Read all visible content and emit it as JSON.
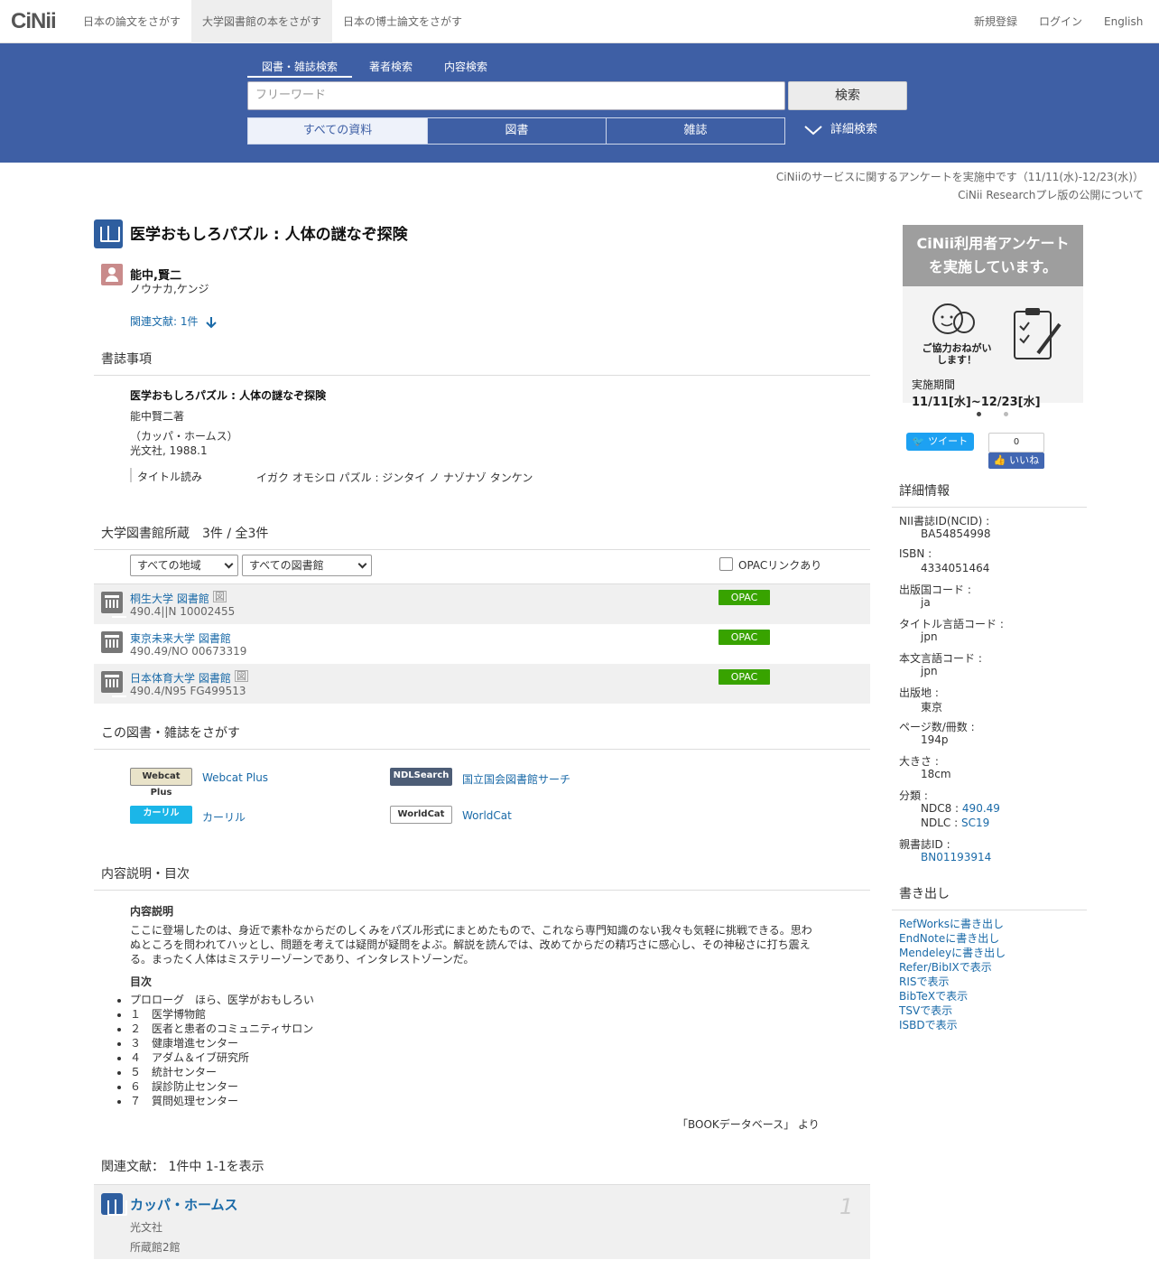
{
  "header": {
    "logo": "CiNii",
    "nav": [
      "日本の論文をさがす",
      "大学図書館の本をさがす",
      "日本の博士論文をさがす"
    ],
    "right": [
      "新規登録",
      "ログイン",
      "English"
    ]
  },
  "search": {
    "tabs": [
      "図書・雑誌検索",
      "著者検索",
      "内容検索"
    ],
    "placeholder": "フリーワード",
    "button": "検索",
    "filters": [
      "すべての資料",
      "図書",
      "雑誌"
    ],
    "advanced": "詳細検索"
  },
  "notices": [
    "CiNiiのサービスに関するアンケートを実施中です（11/11(水)-12/23(水)）",
    "CiNii Researchプレ版の公開について"
  ],
  "book": {
    "title": "医学おもしろパズル : 人体の謎なぞ探険",
    "author": "能中,賢二",
    "author_kana": "ノウナカ,ケンジ",
    "related_link": "関連文献: 1件"
  },
  "biblio": {
    "heading": "書誌事項",
    "title": "医学おもしろパズル : 人体の謎なぞ探険",
    "author_line": "能中賢二著",
    "series": "（カッパ・ホームス）",
    "publisher": "光文社, 1988.1",
    "reading_label": "タイトル読み",
    "reading_value": "イガク オモシロ パズル : ジンタイ ノ ナゾナゾ タンケン"
  },
  "holdings": {
    "heading": "大学図書館所蔵　3件 / 全3件",
    "region_select": "すべての地域",
    "library_select": "すべての図書館",
    "opac_filter": "OPACリンクあり",
    "opac_label": "OPAC",
    "list_icon": "図",
    "rows": [
      {
        "name": "桐生大学 図書館",
        "code": "490.4||N  10002455",
        "has_icon": true
      },
      {
        "name": "東京未来大学 図書館",
        "code": "490.49/NO  00673319",
        "has_icon": false
      },
      {
        "name": "日本体育大学 図書館",
        "code": "490.4/N95  FG499513",
        "has_icon": true
      }
    ]
  },
  "find": {
    "heading": "この図書・雑誌をさがす",
    "items": [
      {
        "logo": "Webcat Plus",
        "label": "Webcat Plus"
      },
      {
        "logo": "NDLSearch",
        "label": "国立国会図書館サーチ"
      },
      {
        "logo": "カーリル",
        "label": "カーリル"
      },
      {
        "logo": "WorldCat",
        "label": "WorldCat"
      }
    ]
  },
  "contents": {
    "heading": "内容説明・目次",
    "desc_label": "内容説明",
    "desc_lines": [
      "ここに登場したのは、身近で素朴なからだのしくみをパズル形式にまとめたもので、これなら専門知識のない我々も気軽に挑戦できる。思わ",
      "ぬところを問われてハッとし、問題を考えては疑問が疑問をよぶ。解説を読んでは、改めてからだの精巧さに感心し、その神秘さに打ち震え",
      "る。まったく人体はミステリーゾーンであり、インタレストゾーンだ。"
    ],
    "toc_label": "目次",
    "toc": [
      "プロローグ　ほら、医学がおもしろい",
      "１　医学博物館",
      "２　医者と患者のコミュニティサロン",
      "３　健康増進センター",
      "４　アダム＆イブ研究所",
      "５　統計センター",
      "６　誤診防止センター",
      "７　質問処理センター"
    ],
    "source": "「BOOKデータベース」 より"
  },
  "related": {
    "heading": "関連文献：  1件中   1-1を表示",
    "item_title": "カッパ・ホームス",
    "item_publisher": "光文社",
    "item_holdings": "所蔵館2館",
    "item_index": "1"
  },
  "sidebar": {
    "ad_title_1": "CiNii利用者アンケート",
    "ad_title_2": "を実施しています。",
    "ad_request_1": "ご協力おねがい",
    "ad_request_2": "します！",
    "ad_period_label": "実施期間",
    "ad_period": "11/11[水]~12/23[水]",
    "tweet": "ツイート",
    "like_count": "0",
    "like": "いいね",
    "details_heading": "詳細情報",
    "details": [
      {
        "label": "NII書誌ID(NCID) :",
        "value": "BA54854998"
      },
      {
        "label": "ISBN :",
        "value": "4334051464"
      },
      {
        "label": "出版国コード :",
        "value": "ja"
      },
      {
        "label": "タイトル言語コード :",
        "value": "jpn"
      },
      {
        "label": "本文言語コード :",
        "value": "jpn"
      },
      {
        "label": "出版地 :",
        "value": "東京"
      },
      {
        "label": "ページ数/冊数 :",
        "value": "194p"
      },
      {
        "label": "大きさ :",
        "value": "18cm"
      }
    ],
    "class_label": "分類 :",
    "ndc8_label": "NDC8 :",
    "ndc8_value": "490.49",
    "ndlc_label": "NDLC :",
    "ndlc_value": "SC19",
    "parent_label": "親書誌ID :",
    "parent_value": "BN01193914",
    "export_heading": "書き出し",
    "exports": [
      "RefWorksに書き出し",
      "EndNoteに書き出し",
      "Mendeleyに書き出し",
      "Refer/BibIXで表示",
      "RISで表示",
      "BibTeXで表示",
      "TSVで表示",
      "ISBDで表示"
    ]
  }
}
